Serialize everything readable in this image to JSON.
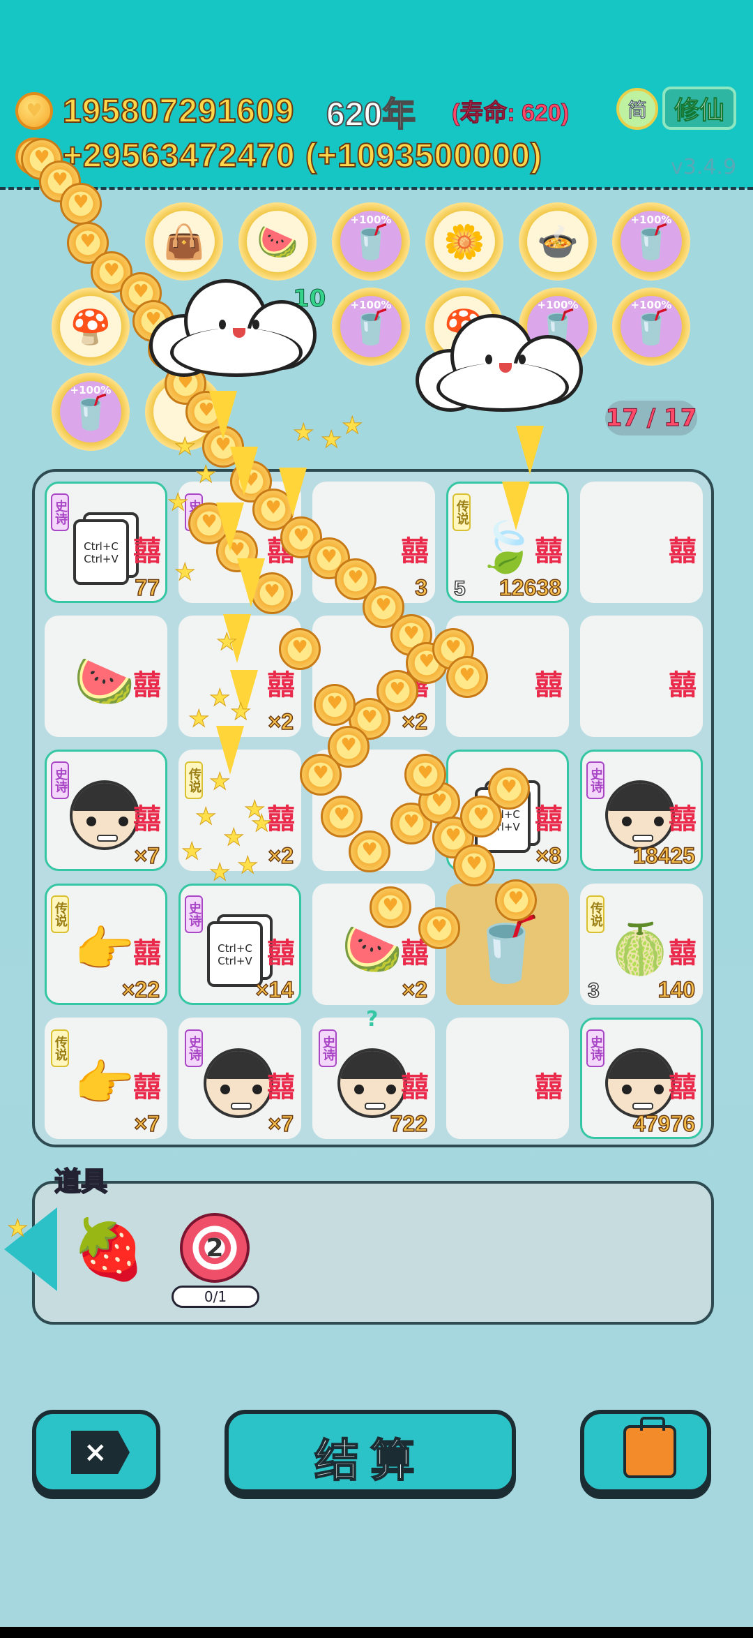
{
  "header": {
    "coins": "195807291609",
    "years": "620年",
    "lifespan": "(寿命: 620)",
    "income": "+29563472470 (+1093500000)",
    "lang_button": "简",
    "mode_button": "修仙",
    "version": "v3.4.9"
  },
  "relics": {
    "pct_label": "+100%",
    "stack_count": "10",
    "capacity": "17 / 17"
  },
  "board": {
    "cells": [
      {
        "tag": "史诗",
        "cnt": "77",
        "epic": true
      },
      {
        "tag": "史诗",
        "cnt": ""
      },
      {
        "tag": "",
        "cnt": "3"
      },
      {
        "tag": "传说",
        "cnt": "12638",
        "lvl": "5",
        "epic": true
      },
      {
        "tag": "",
        "cnt": ""
      },
      {
        "tag": "",
        "cnt": ""
      },
      {
        "tag": "",
        "cnt": "×2"
      },
      {
        "tag": "",
        "cnt": "×2"
      },
      {
        "tag": "",
        "cnt": ""
      },
      {
        "tag": "",
        "cnt": ""
      },
      {
        "tag": "史诗",
        "cnt": "×7",
        "epic": true
      },
      {
        "tag": "传说",
        "cnt": "×2"
      },
      {
        "tag": "",
        "cnt": ""
      },
      {
        "tag": "",
        "cnt": "×8",
        "epic": true
      },
      {
        "tag": "史诗",
        "cnt": "18425",
        "epic": true
      },
      {
        "tag": "传说",
        "cnt": "×22",
        "epic": true
      },
      {
        "tag": "史诗",
        "cnt": "×14",
        "epic": true
      },
      {
        "tag": "",
        "cnt": "×2"
      },
      {
        "tag": "",
        "cnt": ""
      },
      {
        "tag": "传说",
        "cnt": "140",
        "lvl": "3"
      },
      {
        "tag": "传说",
        "cnt": "×7"
      },
      {
        "tag": "史诗",
        "cnt": "×7"
      },
      {
        "tag": "史诗",
        "cnt": "722",
        "mark": "?"
      },
      {
        "tag": "",
        "cnt": ""
      },
      {
        "tag": "史诗",
        "cnt": "47976",
        "epic": true
      }
    ],
    "xi": "囍",
    "card_text": "Ctrl+C\nCtrl+V"
  },
  "props": {
    "label": "道具",
    "target_count": "2",
    "target_progress": "0/1"
  },
  "buttons": {
    "settle": "结算",
    "close_icon": "×"
  },
  "icons": [
    "coin-icon",
    "cloud-icon",
    "lightning-icon",
    "star-icon",
    "strawberry-icon",
    "target-icon",
    "briefcase-icon",
    "close-icon",
    "watermelon-icon",
    "hand-icon",
    "face-icon",
    "cup-icon",
    "longan-icon"
  ]
}
